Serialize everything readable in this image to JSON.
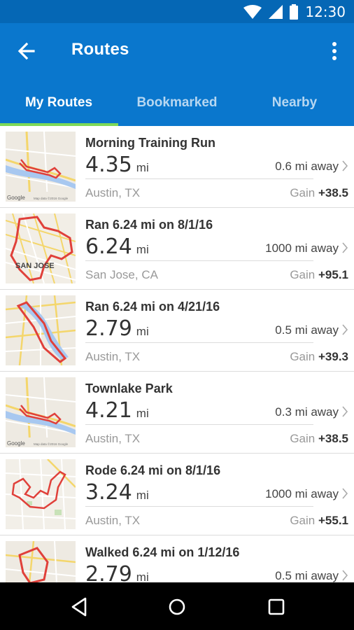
{
  "status_bar": {
    "time": "12:30",
    "icons": [
      "wifi-icon",
      "signal-icon",
      "battery-icon"
    ]
  },
  "app_bar": {
    "title": "Routes",
    "back_icon": "arrow-left-icon",
    "menu_icon": "more-vert-icon"
  },
  "tabs": [
    {
      "label": "My Routes",
      "active": true
    },
    {
      "label": "Bookmarked",
      "active": false
    },
    {
      "label": "Nearby",
      "active": false
    }
  ],
  "colors": {
    "app_bar": "#0a77cd",
    "status_bar": "#0567b5",
    "tab_indicator": "#7ed957",
    "route_line": "#e0403a"
  },
  "routes": [
    {
      "name": "Morning Training Run",
      "distance": "4.35",
      "unit": "mi",
      "away": "0.6 mi away",
      "location": "Austin, TX",
      "gain_label": "Gain",
      "gain_value": "+38.5",
      "map_label": "Google",
      "map_credit": "Map data ©2016 Google"
    },
    {
      "name": "Ran 6.24 mi on 8/1/16",
      "distance": "6.24",
      "unit": "mi",
      "away": "1000 mi away",
      "location": "San Jose, CA",
      "gain_label": "Gain",
      "gain_value": "+95.1",
      "map_label": "SAN JOSE"
    },
    {
      "name": "Ran 6.24 mi on 4/21/16",
      "distance": "2.79",
      "unit": "mi",
      "away": "0.5 mi away",
      "location": "Austin, TX",
      "gain_label": "Gain",
      "gain_value": "+39.3"
    },
    {
      "name": "Townlake Park",
      "distance": "4.21",
      "unit": "mi",
      "away": "0.3 mi away",
      "location": "Austin, TX",
      "gain_label": "Gain",
      "gain_value": "+38.5",
      "map_label": "Google",
      "map_credit": "Map data ©2016 Google"
    },
    {
      "name": "Rode 6.24 mi on 8/1/16",
      "distance": "3.24",
      "unit": "mi",
      "away": "1000 mi away",
      "location": "Austin, TX",
      "gain_label": "Gain",
      "gain_value": "+55.1"
    },
    {
      "name": "Walked 6.24 mi on 1/12/16",
      "distance": "2.79",
      "unit": "mi",
      "away": "0.5 mi away",
      "location": "",
      "gain_label": "",
      "gain_value": ""
    }
  ],
  "nav_bar": {
    "buttons": [
      "back-triangle-icon",
      "home-circle-icon",
      "recents-square-icon"
    ]
  }
}
